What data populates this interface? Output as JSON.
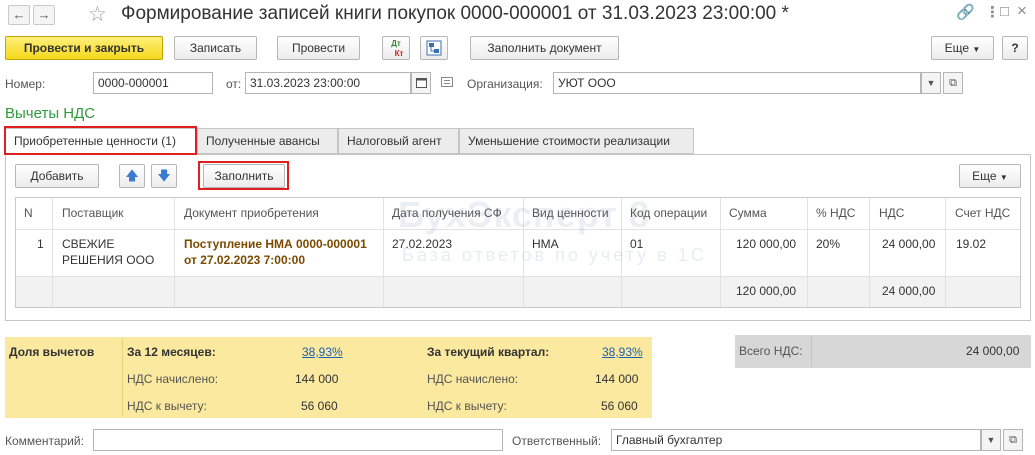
{
  "window": {
    "title": "Формирование записей книги покупок 0000-000001 от 31.03.2023 23:00:00 *",
    "back_icon": "←",
    "forward_icon": "→",
    "link_icon": "🔗",
    "menu_icon": "⋮",
    "maximize_icon": "□",
    "close_icon": "×"
  },
  "toolbar": {
    "post_close": "Провести и закрыть",
    "save": "Записать",
    "post": "Провести",
    "dtkt_top": "Дт",
    "dtkt_bottom": "Кт",
    "fill_document": "Заполнить документ",
    "more": "Еще"
  },
  "header": {
    "number_label": "Номер:",
    "number_value": "0000-000001",
    "date_label": "от:",
    "date_value": "31.03.2023 23:00:00",
    "org_label": "Организация:",
    "org_value": "УЮТ ООО"
  },
  "section_title": "Вычеты НДС",
  "tabs": [
    {
      "label": "Приобретенные ценности (1)"
    },
    {
      "label": "Полученные авансы"
    },
    {
      "label": "Налоговый агент"
    },
    {
      "label": "Уменьшение стоимости реализации"
    }
  ],
  "table_toolbar": {
    "add": "Добавить",
    "fill": "Заполнить",
    "more": "Еще"
  },
  "table": {
    "columns": [
      "N",
      "Поставщик",
      "Документ приобретения",
      "Дата получения СФ",
      "Вид ценности",
      "Код операции",
      "Сумма",
      "% НДС",
      "НДС",
      "Счет НДС"
    ],
    "row": {
      "n": "1",
      "supplier_line1": "СВЕЖИЕ",
      "supplier_line2": "РЕШЕНИЯ ООО",
      "doc_line1": "Поступление НМА 0000-000001",
      "doc_line2": "от 27.02.2023 7:00:00",
      "invoice_date": "27.02.2023",
      "asset_type": "НМА",
      "op_code": "01",
      "sum": "120 000,00",
      "vat_rate": "20%",
      "vat": "24 000,00",
      "vat_account": "19.02"
    },
    "footer": {
      "sum": "120 000,00",
      "vat": "24 000,00"
    }
  },
  "watermark": {
    "line1": "БухЭксперт 8",
    "line2": "База ответов по учету в 1С"
  },
  "summary": {
    "share_label": "Доля вычетов",
    "period12_label": "За 12 месяцев:",
    "period12_value": "38,93%",
    "quarter_label": "За текущий квартал:",
    "quarter_value": "38,93%",
    "vat_charged_label": "НДС начислено:",
    "vat_charged_12": "144 000",
    "vat_charged_q": "144 000",
    "vat_deduct_label": "НДС к вычету:",
    "vat_deduct_12": "56 060",
    "vat_deduct_q": "56 060",
    "total_vat_label": "Всего НДС:",
    "total_vat_value": "24 000,00"
  },
  "footer": {
    "comment_label": "Комментарий:",
    "comment_value": "",
    "responsible_label": "Ответственный:",
    "responsible_value": "Главный бухгалтер"
  }
}
